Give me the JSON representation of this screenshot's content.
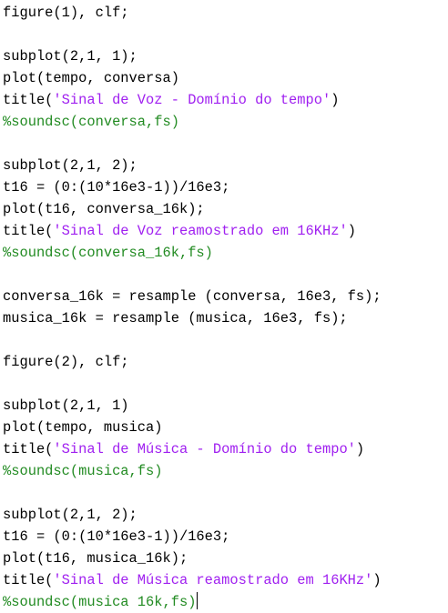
{
  "editor": {
    "colors": {
      "code": "#000000",
      "string": "#a020f0",
      "comment": "#228b22"
    },
    "lines": [
      [
        {
          "t": "code",
          "v": "figure(1), clf;"
        }
      ],
      [],
      [
        {
          "t": "code",
          "v": "subplot(2,1, 1);"
        }
      ],
      [
        {
          "t": "code",
          "v": "plot(tempo, conversa)"
        }
      ],
      [
        {
          "t": "code",
          "v": "title("
        },
        {
          "t": "str",
          "v": "'Sinal de Voz - Domínio do tempo'"
        },
        {
          "t": "code",
          "v": ")"
        }
      ],
      [
        {
          "t": "comment",
          "v": "%soundsc(conversa,fs)"
        }
      ],
      [],
      [
        {
          "t": "code",
          "v": "subplot(2,1, 2);"
        }
      ],
      [
        {
          "t": "code",
          "v": "t16 = (0:(10*16e3-1))/16e3;"
        }
      ],
      [
        {
          "t": "code",
          "v": "plot(t16, conversa_16k);"
        }
      ],
      [
        {
          "t": "code",
          "v": "title("
        },
        {
          "t": "str",
          "v": "'Sinal de Voz reamostrado em 16KHz'"
        },
        {
          "t": "code",
          "v": ")"
        }
      ],
      [
        {
          "t": "comment",
          "v": "%soundsc(conversa_16k,fs)"
        }
      ],
      [],
      [
        {
          "t": "code",
          "v": "conversa_16k = resample (conversa, 16e3, fs);"
        }
      ],
      [
        {
          "t": "code",
          "v": "musica_16k = resample (musica, 16e3, fs);"
        }
      ],
      [],
      [
        {
          "t": "code",
          "v": "figure(2), clf;"
        }
      ],
      [],
      [
        {
          "t": "code",
          "v": "subplot(2,1, 1)"
        }
      ],
      [
        {
          "t": "code",
          "v": "plot(tempo, musica)"
        }
      ],
      [
        {
          "t": "code",
          "v": "title("
        },
        {
          "t": "str",
          "v": "'Sinal de Música - Domínio do tempo'"
        },
        {
          "t": "code",
          "v": ")"
        }
      ],
      [
        {
          "t": "comment",
          "v": "%soundsc(musica,fs)"
        }
      ],
      [],
      [
        {
          "t": "code",
          "v": "subplot(2,1, 2);"
        }
      ],
      [
        {
          "t": "code",
          "v": "t16 = (0:(10*16e3-1))/16e3;"
        }
      ],
      [
        {
          "t": "code",
          "v": "plot(t16, musica_16k);"
        }
      ],
      [
        {
          "t": "code",
          "v": "title("
        },
        {
          "t": "str",
          "v": "'Sinal de Música reamostrado em 16KHz'"
        },
        {
          "t": "code",
          "v": ")"
        }
      ],
      [
        {
          "t": "comment",
          "v": "%soundsc(musica 16k,fs)"
        }
      ]
    ],
    "caret_line": 27
  }
}
